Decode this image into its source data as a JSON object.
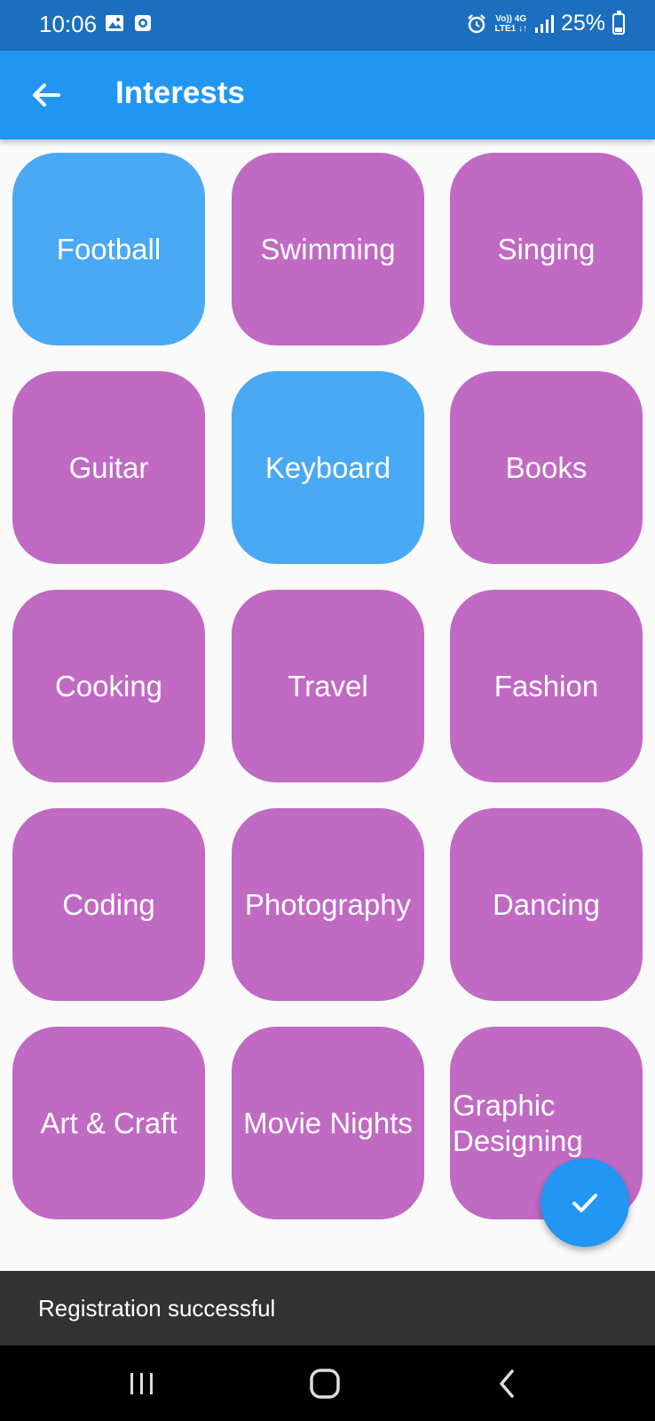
{
  "status_bar": {
    "time": "10:06",
    "network_top": "Vo)) 4G",
    "network_bottom": "LTE1 ↓↑",
    "battery": "25%"
  },
  "app_bar": {
    "title": "Interests",
    "back_icon": "arrow-left-icon",
    "color": "#2196f3"
  },
  "colors": {
    "tile_default": "#c06ac4",
    "tile_selected": "#4aa9f4"
  },
  "interests": [
    {
      "label": "Football",
      "selected": true
    },
    {
      "label": "Swimming",
      "selected": false
    },
    {
      "label": "Singing",
      "selected": false
    },
    {
      "label": "Guitar",
      "selected": false
    },
    {
      "label": "Keyboard",
      "selected": true
    },
    {
      "label": "Books",
      "selected": false
    },
    {
      "label": "Cooking",
      "selected": false
    },
    {
      "label": "Travel",
      "selected": false
    },
    {
      "label": "Fashion",
      "selected": false
    },
    {
      "label": "Coding",
      "selected": false
    },
    {
      "label": "Photography",
      "selected": false
    },
    {
      "label": "Dancing",
      "selected": false
    },
    {
      "label": "Art & Craft",
      "selected": false
    },
    {
      "label": "Movie Nights",
      "selected": false
    },
    {
      "label": "Graphic Designing",
      "selected": false
    }
  ],
  "fab": {
    "icon": "check-icon"
  },
  "snackbar": {
    "message": "Registration successful"
  },
  "nav_bar": {
    "icons": [
      "recent-apps-icon",
      "home-icon",
      "back-icon"
    ]
  }
}
